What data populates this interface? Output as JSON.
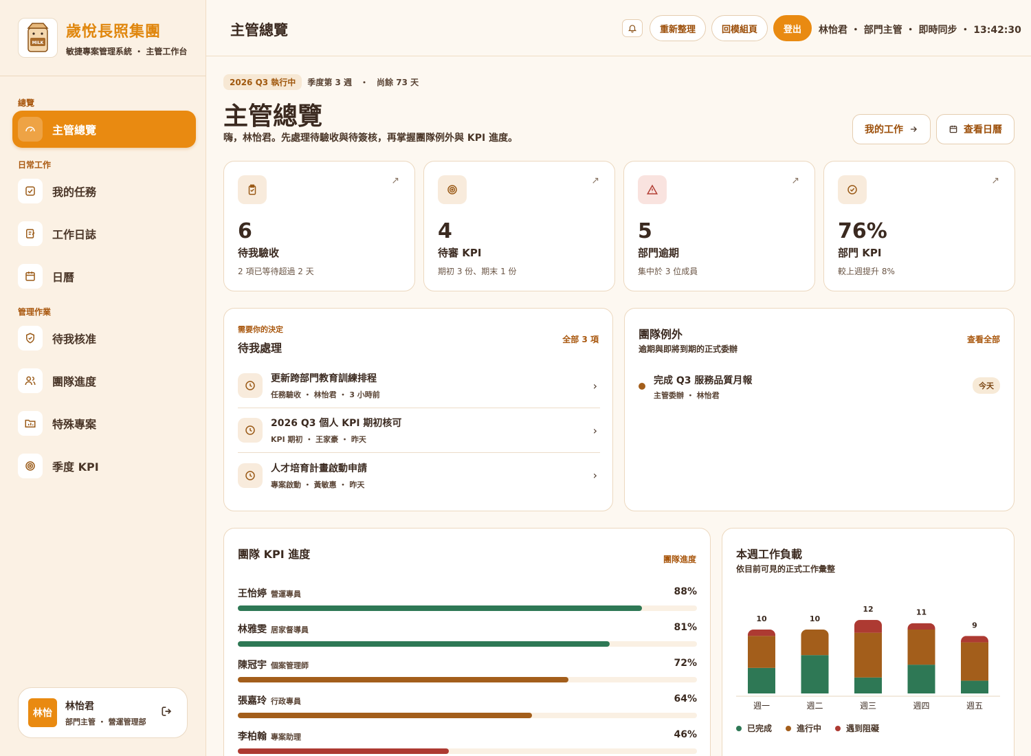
{
  "brand": {
    "name": "歲悅長照集團",
    "subtitle": "敏捷專案管理系統 ・ 主管工作台",
    "logo_text": "MILK"
  },
  "sidebar": {
    "sections": [
      {
        "label": "總覽"
      },
      {
        "label": "日常工作"
      },
      {
        "label": "管理作業"
      }
    ],
    "items": [
      {
        "label": "主管總覽",
        "icon": "gauge-icon"
      },
      {
        "label": "我的任務",
        "icon": "checkbox-icon"
      },
      {
        "label": "工作日誌",
        "icon": "journal-icon"
      },
      {
        "label": "日曆",
        "icon": "calendar-icon"
      },
      {
        "label": "待我核准",
        "icon": "shield-check-icon"
      },
      {
        "label": "團隊進度",
        "icon": "users-icon"
      },
      {
        "label": "特殊專案",
        "icon": "folder-chart-icon"
      },
      {
        "label": "季度 KPI",
        "icon": "target-icon"
      }
    ],
    "user": {
      "avatar_text": "林怡",
      "name": "林怡君",
      "role": "部門主管 ・ 營運管理部"
    }
  },
  "topbar": {
    "title": "主管總覽",
    "refresh_label": "重新整理",
    "back_label": "回模組頁",
    "logout_label": "登出",
    "status": "林怡君 ・ 部門主管 ・ 即時同步 ・ 13:42:30"
  },
  "header": {
    "quarter_badge": "2026 Q3 執行中",
    "week": "季度第 3 週",
    "sep": "・",
    "days_left": "尚餘 73 天",
    "title": "主管總覽",
    "greeting": "嗨，林怡君。先處理待驗收與待簽核，再掌握團隊例外與 KPI 進度。",
    "my_work_label": "我的工作",
    "calendar_label": "查看日曆"
  },
  "kpis": [
    {
      "value": "6",
      "label": "待我驗收",
      "note": "2 項已等待超過 2 天"
    },
    {
      "value": "4",
      "label": "待審 KPI",
      "note": "期初 3 份、期末 1 份"
    },
    {
      "value": "5",
      "label": "部門逾期",
      "note": "集中於 3 位成員"
    },
    {
      "value": "76%",
      "label": "部門 KPI",
      "note": "較上週提升 8%"
    }
  ],
  "pending": {
    "eyebrow": "需要你的決定",
    "title": "待我處理",
    "link": "全部 3 項",
    "items": [
      {
        "title": "更新跨部門教育訓練排程",
        "meta": "任務驗收 ・ 林怡君 ・ 3 小時前"
      },
      {
        "title": "2026 Q3 個人 KPI 期初核可",
        "meta": "KPI 期初 ・ 王家豪 ・ 昨天"
      },
      {
        "title": "人才培育計畫啟動申請",
        "meta": "專案啟動 ・ 黃敏惠 ・ 昨天"
      }
    ]
  },
  "exceptions": {
    "title": "團隊例外",
    "subtitle": "逾期與即將到期的正式委辦",
    "link": "查看全部",
    "items": [
      {
        "title": "完成 Q3 服務品質月報",
        "meta": "主管委辦 ・ 林怡君",
        "badge": "今天"
      }
    ]
  },
  "team_kpi": {
    "title": "團隊 KPI 進度",
    "link": "團隊進度",
    "members": [
      {
        "name": "王怡婷",
        "role": "營運專員",
        "pct_label": "88%",
        "pct": 88,
        "color": "#2e7855"
      },
      {
        "name": "林雅雯",
        "role": "居家督導員",
        "pct_label": "81%",
        "pct": 81,
        "color": "#2e7855"
      },
      {
        "name": "陳冠宇",
        "role": "個案管理師",
        "pct_label": "72%",
        "pct": 72,
        "color": "#a35e1b"
      },
      {
        "name": "張嘉玲",
        "role": "行政專員",
        "pct_label": "64%",
        "pct": 64,
        "color": "#a35e1b"
      },
      {
        "name": "李柏翰",
        "role": "專案助理",
        "pct_label": "46%",
        "pct": 46,
        "color": "#ad3a32"
      }
    ]
  },
  "workload": {
    "title": "本週工作負載",
    "subtitle": "依目前可見的正式工作彙整",
    "legend": [
      "已完成",
      "進行中",
      "遇到阻礙"
    ],
    "colors": {
      "done": "#2e7855",
      "progress": "#a35e1b",
      "blocked": "#ad3a32"
    }
  },
  "chart_data": {
    "type": "bar",
    "stacked": true,
    "categories": [
      "週一",
      "週二",
      "週三",
      "週四",
      "週五"
    ],
    "totals": [
      10,
      10,
      12,
      11,
      9
    ],
    "series": [
      {
        "name": "已完成",
        "values": [
          4,
          6,
          2.5,
          4.5,
          2
        ]
      },
      {
        "name": "進行中",
        "values": [
          5,
          4,
          7,
          5.5,
          6
        ]
      },
      {
        "name": "遇到阻礙",
        "values": [
          1,
          0,
          2,
          1,
          1
        ]
      }
    ]
  }
}
